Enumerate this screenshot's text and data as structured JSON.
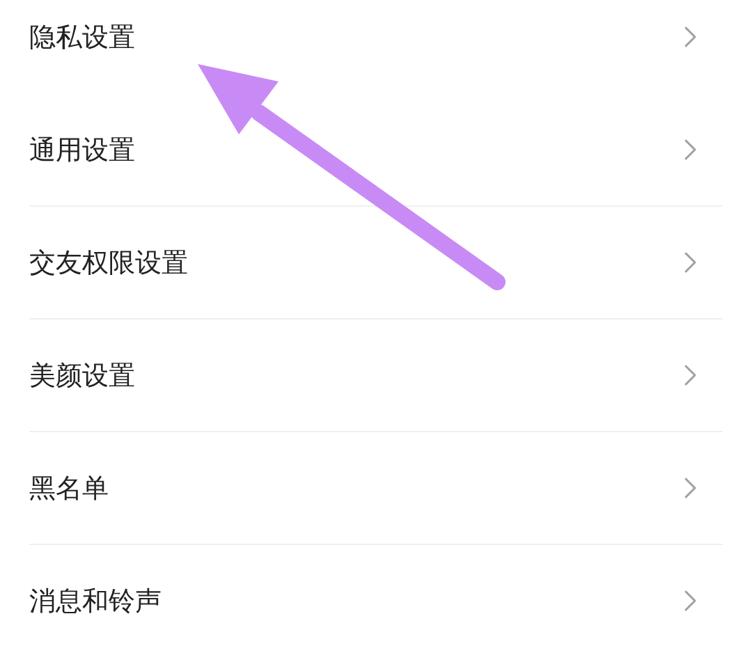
{
  "settings": [
    {
      "label": "隐私设置",
      "separated": false
    },
    {
      "label": "通用设置",
      "separated": false
    },
    {
      "label": "交友权限设置",
      "separated": true
    },
    {
      "label": "美颜设置",
      "separated": true
    },
    {
      "label": "黑名单",
      "separated": true
    },
    {
      "label": "消息和铃声",
      "separated": true
    }
  ]
}
